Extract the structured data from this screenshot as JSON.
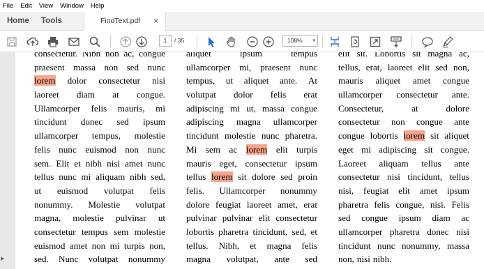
{
  "menu": [
    "File",
    "Edit",
    "View",
    "Window",
    "Help"
  ],
  "nav_tabs": {
    "home": "Home",
    "tools": "Tools"
  },
  "doc_tab": {
    "title": "FindText.pdf",
    "close": "×"
  },
  "toolbar": {
    "page_current": "1",
    "page_total": "/ 35",
    "zoom": "108%",
    "zoom_arrow": "▾",
    "icons": [
      "save-icon",
      "upload-icon",
      "print-icon",
      "email-icon",
      "search-icon",
      "page-up-icon",
      "page-down-icon",
      "select-cursor-icon",
      "hand-icon",
      "zoom-out-icon",
      "zoom-in-icon",
      "fit-page-icon",
      "rotate-icon",
      "fit-screen-icon",
      "scroll-mode-icon",
      "comment-icon",
      "highlight-pen-icon"
    ]
  },
  "highlight_color": "#f7a58d",
  "highlight_word": "lorem",
  "columns": [
    [
      "consectetur. Nibh non ac, congue",
      "praesent massa non sed nunc",
      "[lorem] dolor consectetur nisi",
      "laoreet diam at congue.",
      "Ullamcorper felis mauris, mi",
      "tincidunt donec sed ipsum",
      "ullamcorper tempus, molestie",
      "felis nunc euismod non nunc",
      "sem. Elit et nibh nisi amet nunc",
      "tellus nunc mi aliquam nibh sed,",
      "ut euismod volutpat felis",
      "nonummy. Molestie volutpat",
      "magna, molestie pulvinar ut",
      "consectetur tempus sem molestie",
      "euismod amet non mi turpis non,",
      "sed. Nunc volutpat nonummy"
    ],
    [
      "aliquet ipsum tempus",
      "ullamcorper mi, praesent nunc",
      "tempus, ut aliquet ante. At",
      "volutpat dolor felis erat",
      "adipiscing mi ut, massa congue",
      "adipiscing magna ullamcorper",
      "tincidunt molestie nunc pharetra.",
      "Mi sem ac [lorem] elit turpis",
      "mauris eget, consectetur ipsum",
      "tellus [lorem] sit dolore sed proin",
      "felis. Ullamcorper nonummy",
      "dolore feugiat laoreet amet, erat",
      "pulvinar pulvinar elit consectetur",
      "lobortis pharetra tincidunt, sed, et",
      "tellus. Nibh, et magna felis",
      "magna volutpat, ante sed"
    ],
    [
      "elit sit. Lobortis sit magna ac,",
      "tellus, erat, laoreet elit sed non,",
      "mauris aliquet amet congue",
      "ullamcorper consectetur ante.",
      "Consectetur, at dolore",
      "consectetur non congue ante",
      "congue lobortis [lorem] sit aliquet",
      "eget mi adipiscing sit congue.",
      "Laoreet aliquam tellus ante",
      "consectetur nisi tincidunt, tellus",
      "nisi, feugiat elit amet ipsum",
      "pharetra felis congue, nisi. Felis",
      "sed congue ipsum diam ac",
      "ullamcorper pharetra donec nisi",
      "tincidunt nunc nonummy, massa",
      "non, nisi nibh."
    ]
  ]
}
